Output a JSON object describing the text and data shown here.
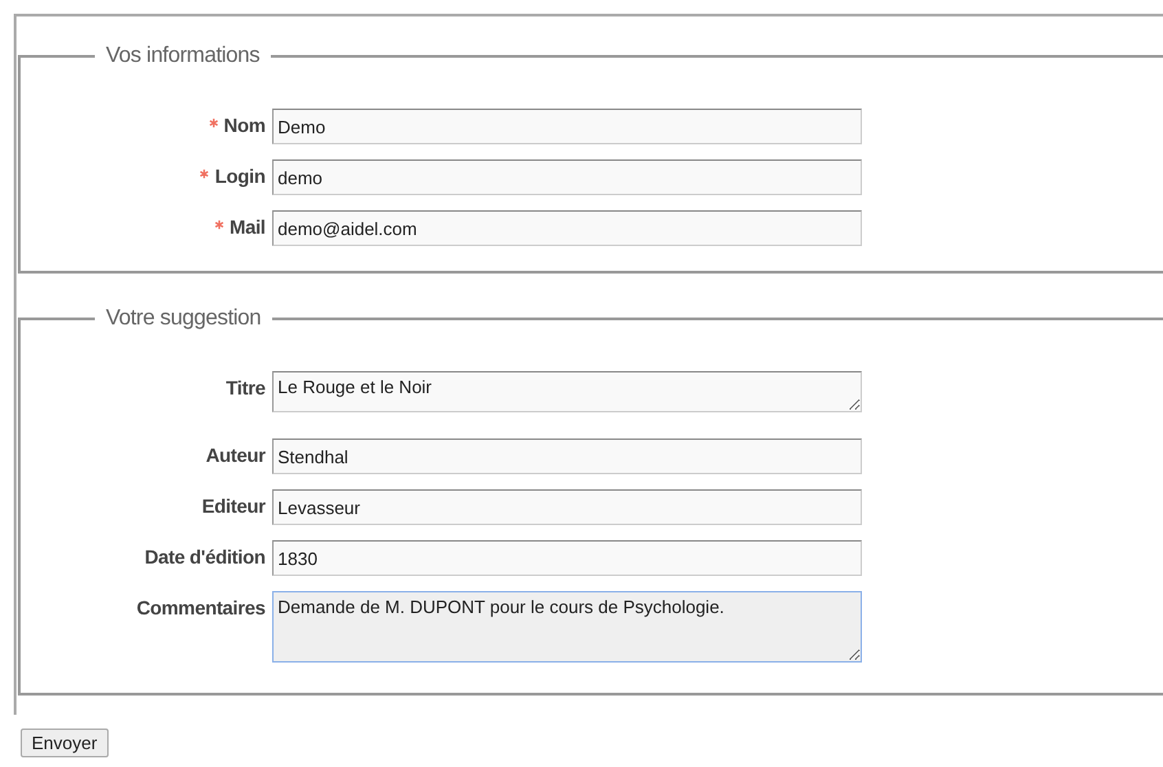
{
  "fieldsets": [
    {
      "legend": "Vos informations",
      "fields": [
        {
          "label": "Nom",
          "kind": "input",
          "required": true,
          "value": "Demo",
          "focused": false
        },
        {
          "label": "Login",
          "kind": "input",
          "required": true,
          "value": "demo",
          "focused": false
        },
        {
          "label": "Mail",
          "kind": "input",
          "required": true,
          "value": "demo@aidel.com",
          "focused": false
        }
      ]
    },
    {
      "legend": "Votre suggestion",
      "fields": [
        {
          "label": "Titre",
          "kind": "textarea",
          "required": false,
          "value": "Le Rouge et le Noir",
          "focused": false
        },
        {
          "label": "Auteur",
          "kind": "input",
          "required": false,
          "value": "Stendhal",
          "focused": false
        },
        {
          "label": "Editeur",
          "kind": "input",
          "required": false,
          "value": "Levasseur",
          "focused": false
        },
        {
          "label": "Date d'édition",
          "kind": "input",
          "required": false,
          "value": "1830",
          "focused": false
        },
        {
          "label": "Commentaires",
          "kind": "textarea-large",
          "required": false,
          "value": "Demande de M. DUPONT pour le cours de Psychologie.",
          "focused": true
        }
      ]
    }
  ],
  "submit": "Envoyer"
}
